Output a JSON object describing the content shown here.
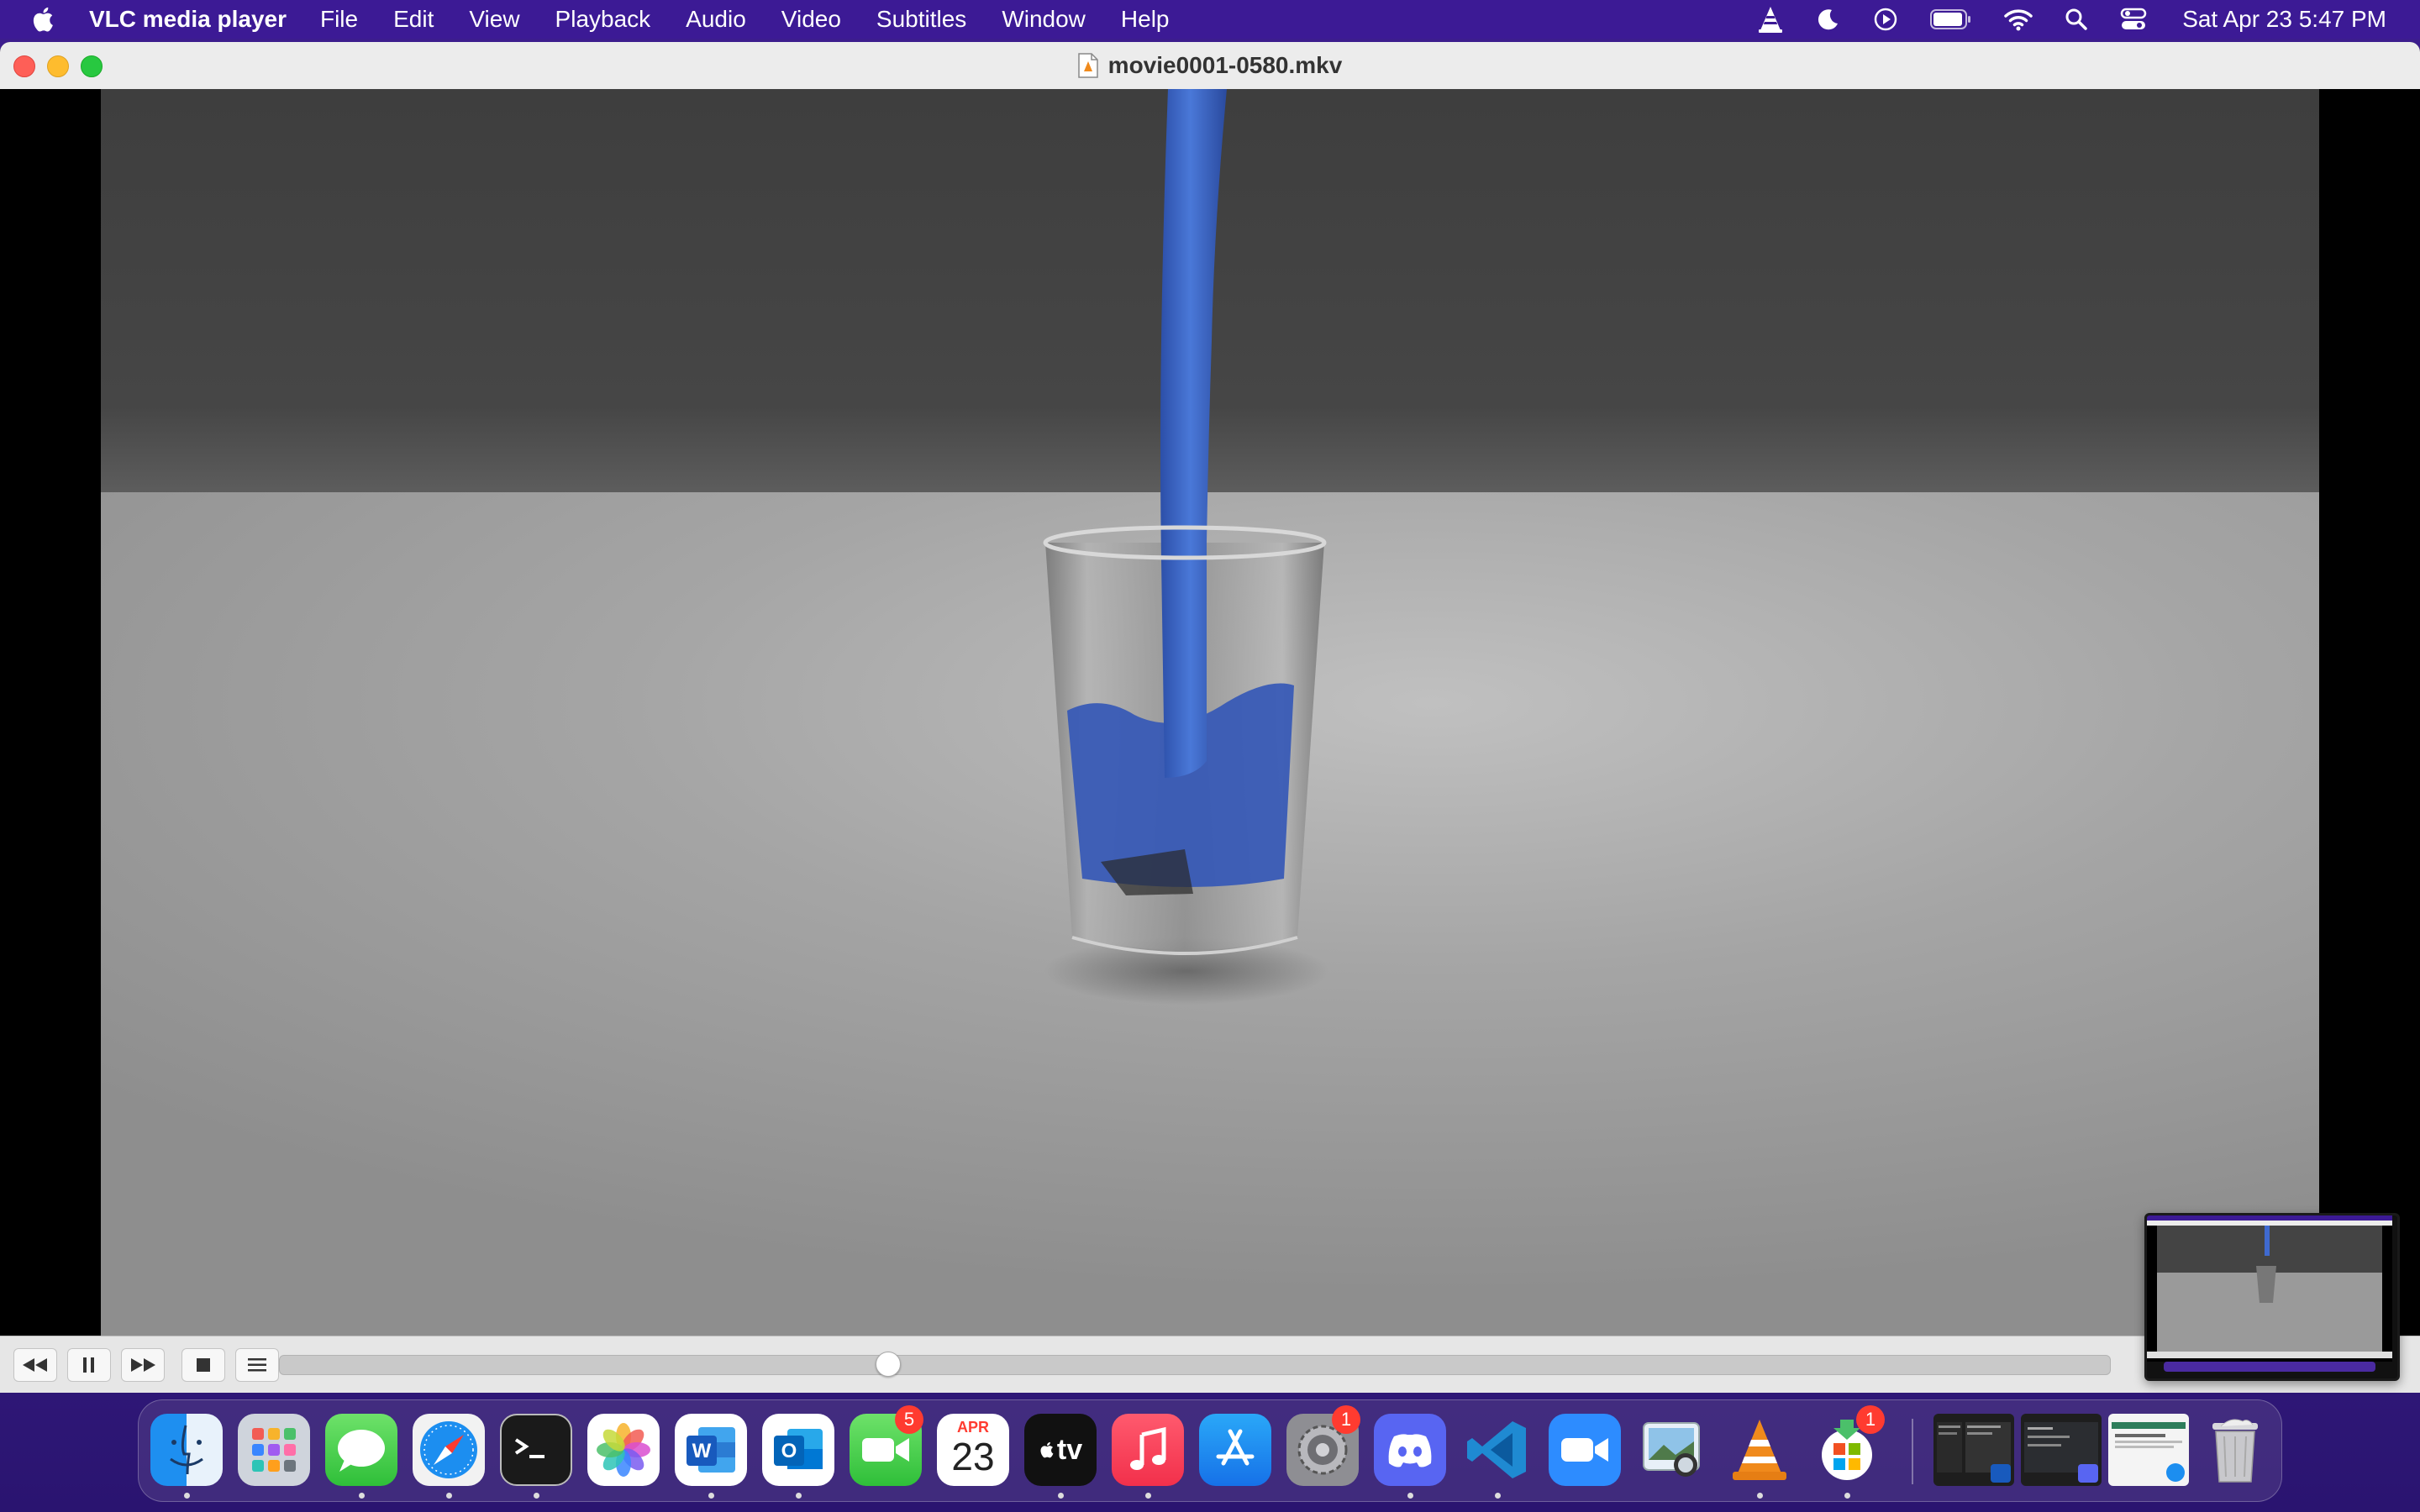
{
  "menubar": {
    "app_name": "VLC media player",
    "menus": [
      "File",
      "Edit",
      "View",
      "Playback",
      "Audio",
      "Video",
      "Subtitles",
      "Window",
      "Help"
    ],
    "clock": "Sat Apr 23  5:47 PM",
    "status_icons": [
      "vlc-cone-icon",
      "moon-icon",
      "play-circle-icon",
      "battery-icon",
      "wifi-icon",
      "search-icon",
      "control-center-icon"
    ]
  },
  "window": {
    "title": "movie0001-0580.mkv"
  },
  "player": {
    "playback_progress": 0.33,
    "buttons": [
      "rewind-icon",
      "pause-icon",
      "fast-forward-icon",
      "stop-icon",
      "playlist-icon"
    ]
  },
  "dock": {
    "apps": [
      {
        "name": "Finder",
        "running": true
      },
      {
        "name": "Launchpad",
        "running": false
      },
      {
        "name": "Messages",
        "running": true
      },
      {
        "name": "Safari",
        "running": true
      },
      {
        "name": "Terminal",
        "running": true
      },
      {
        "name": "Photos",
        "running": false
      },
      {
        "name": "Microsoft Word",
        "running": true
      },
      {
        "name": "Microsoft Outlook",
        "running": true
      },
      {
        "name": "FaceTime",
        "running": false,
        "badge": "5"
      },
      {
        "name": "Calendar",
        "running": false,
        "month": "APR",
        "day": "23"
      },
      {
        "name": "Apple TV",
        "running": true,
        "label": "tv"
      },
      {
        "name": "Music",
        "running": true
      },
      {
        "name": "App Store",
        "running": false
      },
      {
        "name": "System Preferences",
        "running": false,
        "badge": "1"
      },
      {
        "name": "Discord",
        "running": true
      },
      {
        "name": "Visual Studio Code",
        "running": true
      },
      {
        "name": "Zoom",
        "running": false
      },
      {
        "name": "Preview",
        "running": false
      },
      {
        "name": "VLC",
        "running": true
      },
      {
        "name": "Microsoft AutoUpdate",
        "running": true,
        "badge": "1"
      }
    ],
    "minimized_windows": 3,
    "trash": "Trash"
  },
  "colors": {
    "menubar": "#3c1a95",
    "accent_blue": "#3a6fd8",
    "liquid_blue": "#3b63c4"
  }
}
